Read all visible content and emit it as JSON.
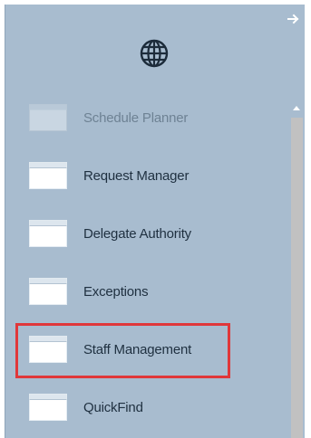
{
  "panel": {
    "collapse_icon": "arrow-right-icon",
    "globe_icon": "globe-icon",
    "colors": {
      "panel_bg": "#a8bccf",
      "text": "#1f3040",
      "disabled_text": "#6e8294",
      "highlight": "#e0373a"
    }
  },
  "menu": {
    "items": [
      {
        "label": "Schedule Planner",
        "icon": "window-icon",
        "state": "disabled"
      },
      {
        "label": "Request Manager",
        "icon": "window-icon",
        "state": "normal"
      },
      {
        "label": "Delegate Authority",
        "icon": "window-icon",
        "state": "normal"
      },
      {
        "label": "Exceptions",
        "icon": "window-icon",
        "state": "normal"
      },
      {
        "label": "Staff Management",
        "icon": "window-icon",
        "state": "highlighted"
      },
      {
        "label": "QuickFind",
        "icon": "window-icon",
        "state": "normal"
      }
    ]
  },
  "scrollbar": {
    "up_icon": "scroll-up-icon"
  }
}
